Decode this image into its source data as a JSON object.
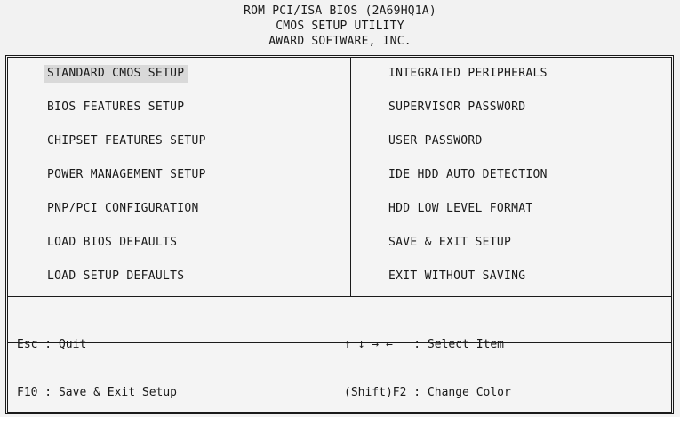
{
  "header": {
    "line1": "ROM PCI/ISA BIOS (2A69HQ1A)",
    "line2": "CMOS SETUP UTILITY",
    "line3": "AWARD SOFTWARE, INC."
  },
  "menu": {
    "left": [
      {
        "label": "STANDARD CMOS SETUP",
        "selected": true
      },
      {
        "label": "BIOS FEATURES SETUP"
      },
      {
        "label": "CHIPSET FEATURES SETUP"
      },
      {
        "label": "POWER MANAGEMENT SETUP"
      },
      {
        "label": "PNP/PCI CONFIGURATION"
      },
      {
        "label": "LOAD BIOS DEFAULTS"
      },
      {
        "label": "LOAD SETUP DEFAULTS"
      }
    ],
    "right": [
      {
        "label": "INTEGRATED PERIPHERALS"
      },
      {
        "label": "SUPERVISOR PASSWORD"
      },
      {
        "label": "USER PASSWORD"
      },
      {
        "label": "IDE HDD AUTO DETECTION"
      },
      {
        "label": "HDD LOW LEVEL FORMAT"
      },
      {
        "label": "SAVE & EXIT SETUP"
      },
      {
        "label": "EXIT WITHOUT SAVING"
      }
    ]
  },
  "help": {
    "esc": "Esc : Quit",
    "f10": "F10 : Save & Exit Setup",
    "arrows": "↑ ↓ → ←   : Select Item",
    "shift_f2": "(Shift)F2 : Change Color"
  },
  "colors": {
    "background": "#f2f2f2",
    "text": "#1a1a1a",
    "highlight": "#d9d9d9"
  }
}
